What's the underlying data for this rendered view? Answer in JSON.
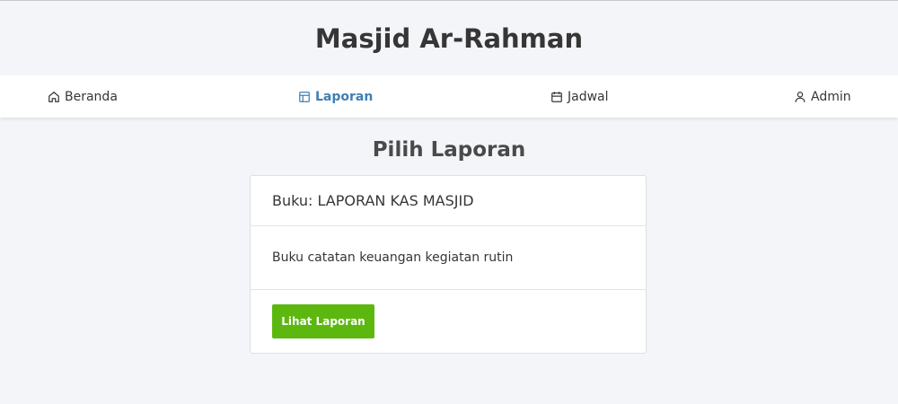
{
  "header": {
    "title": "Masjid Ar-Rahman"
  },
  "nav": {
    "items": [
      {
        "label": "Beranda",
        "icon": "home-icon",
        "active": false
      },
      {
        "label": "Laporan",
        "icon": "layout-icon",
        "active": true
      },
      {
        "label": "Jadwal",
        "icon": "calendar-icon",
        "active": false
      },
      {
        "label": "Admin",
        "icon": "user-icon",
        "active": false
      }
    ]
  },
  "main": {
    "heading": "Pilih Laporan",
    "card": {
      "title": "Buku: LAPORAN KAS MASJID",
      "description": "Buku catatan keuangan kegiatan rutin",
      "button_label": "Lihat Laporan"
    }
  },
  "colors": {
    "accent": "#3e7fb3",
    "button": "#5cb80f",
    "background": "#f4f5f8"
  }
}
